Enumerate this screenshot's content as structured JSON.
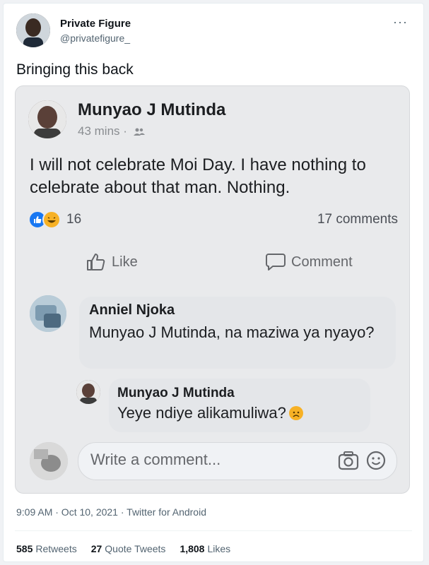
{
  "tweet": {
    "author_name": "Private Figure",
    "author_handle": "@privatefigure_",
    "text": "Bringing this back",
    "more": "···",
    "meta": "9:09 AM · Oct 10, 2021 · Twitter for Android",
    "stats": {
      "retweets_count": "585",
      "retweets_label": "Retweets",
      "quotes_count": "27",
      "quotes_label": "Quote Tweets",
      "likes_count": "1,808",
      "likes_label": "Likes"
    }
  },
  "fb_post": {
    "author": "Munyao J Mutinda",
    "time": "43 mins ·",
    "text": "I will not celebrate Moi Day. I have nothing to celebrate about that man. Nothing.",
    "reactions_count": "16",
    "comments_count": "17 comments",
    "like_label": "Like",
    "comment_label": "Comment",
    "comments": [
      {
        "author": "Anniel Njoka",
        "text": "Munyao J Mutinda, na maziwa ya nyayo?"
      },
      {
        "author": "Munyao J Mutinda",
        "text": "Yeye ndiye alikamuliwa?"
      }
    ],
    "write_placeholder": "Write a comment..."
  },
  "colors": {
    "fb_blue": "#1877f2",
    "haha_yellow": "#f7b125",
    "twitter_gray": "#536471"
  },
  "icons": [
    "more-icon",
    "friends-icon",
    "like-reaction-icon",
    "haha-reaction-icon",
    "thumbs-up-icon",
    "comment-icon",
    "sad-emoji-icon",
    "camera-icon",
    "emoji-icon"
  ]
}
